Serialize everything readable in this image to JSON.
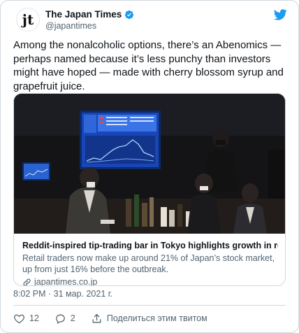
{
  "account": {
    "display_name": "The Japan Times",
    "handle": "@japantimes",
    "avatar_text": "jt"
  },
  "tweet": {
    "text": "Among the nonalcoholic options, there’s an Abenomics — perhaps named because it’s less punchy than investors might have hoped — made with cherry blossom syrup and grapefruit juice.",
    "timestamp": "8:02 PM · 31 мар. 2021 г."
  },
  "card": {
    "title": "Reddit-inspired tip-trading bar in Tokyo highlights growth in retail inv...",
    "description": "Retail traders now make up around 21% of Japan’s stock market, up from just 16% before the outbreak.",
    "domain": "japantimes.co.jp"
  },
  "actions": {
    "like_count": "12",
    "reply_count": "2",
    "share_label": "Поделиться этим твитом"
  },
  "colors": {
    "twitter_blue": "#1d9bf0",
    "text_primary": "#0f1419",
    "text_secondary": "#536471",
    "border": "#cfd9de"
  },
  "icons": [
    "verified-badge-icon",
    "twitter-bird-icon",
    "link-icon",
    "heart-icon",
    "reply-bubble-icon",
    "share-upload-icon"
  ]
}
